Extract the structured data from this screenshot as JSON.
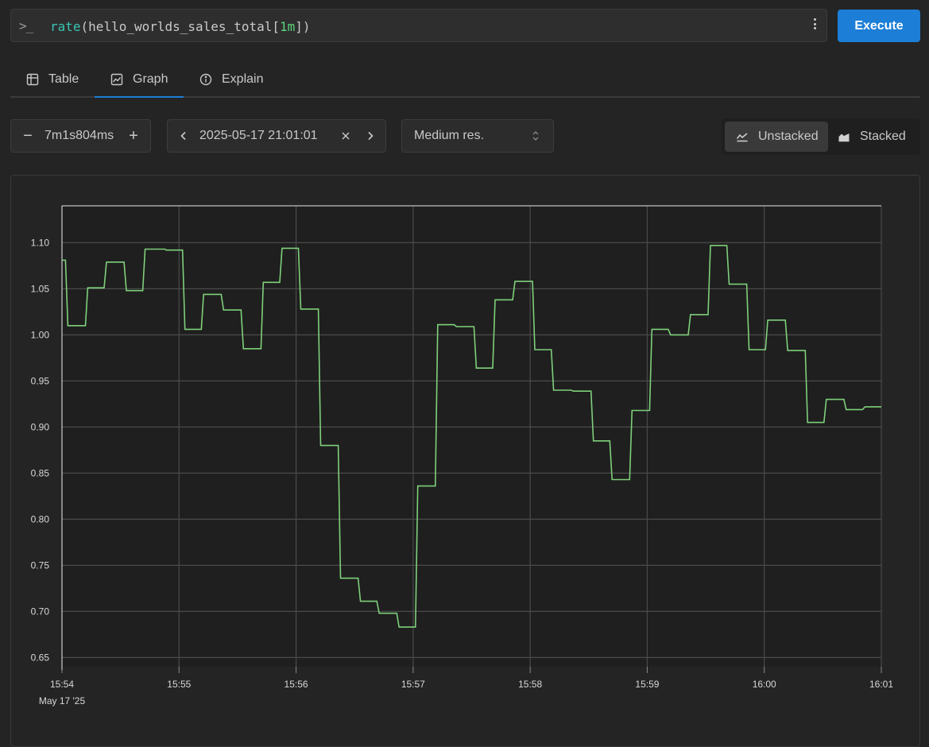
{
  "query": {
    "prompt": ">_",
    "fn": "rate",
    "open": "(",
    "metric": "hello_worlds_sales_total",
    "range_open": "[",
    "range": "1m",
    "close": "])",
    "more_icon": "dots-vertical-icon"
  },
  "execute_label": "Execute",
  "tabs": [
    {
      "label": "Table",
      "icon": "table-icon",
      "active": false
    },
    {
      "label": "Graph",
      "icon": "chart-area-icon",
      "active": true
    },
    {
      "label": "Explain",
      "icon": "info-circle-icon",
      "active": false
    }
  ],
  "controls": {
    "range_value": "7m1s804ms",
    "range_minus": "−",
    "range_plus": "+",
    "end_time": "2025-05-17 21:01:01",
    "resolution": "Medium res.",
    "unstacked_label": "Unstacked",
    "stacked_label": "Stacked"
  },
  "colors": {
    "accent": "#1c7ed6",
    "series": "#7ed07a",
    "background": "#242424"
  },
  "chart_data": {
    "type": "line",
    "x_ticks": [
      "15:54",
      "15:55",
      "15:56",
      "15:57",
      "15:58",
      "15:59",
      "16:00",
      "16:01"
    ],
    "x_date_label": "May 17 '25",
    "xlim_minutes": [
      0,
      7
    ],
    "ylim": [
      0.64,
      1.14
    ],
    "y_ticks": [
      "0.65",
      "0.70",
      "0.75",
      "0.80",
      "0.85",
      "0.90",
      "0.95",
      "1.00",
      "1.05",
      "1.10"
    ],
    "grid": true,
    "series": [
      {
        "step": true,
        "points": [
          [
            0.0,
            1.081
          ],
          [
            0.03,
            1.081
          ],
          [
            0.05,
            1.01
          ],
          [
            0.2,
            1.01
          ],
          [
            0.22,
            1.051
          ],
          [
            0.36,
            1.051
          ],
          [
            0.38,
            1.079
          ],
          [
            0.53,
            1.079
          ],
          [
            0.55,
            1.048
          ],
          [
            0.69,
            1.048
          ],
          [
            0.71,
            1.093
          ],
          [
            0.88,
            1.093
          ],
          [
            0.89,
            1.092
          ],
          [
            1.03,
            1.092
          ],
          [
            1.05,
            1.006
          ],
          [
            1.19,
            1.006
          ],
          [
            1.21,
            1.044
          ],
          [
            1.36,
            1.044
          ],
          [
            1.38,
            1.027
          ],
          [
            1.53,
            1.027
          ],
          [
            1.55,
            0.985
          ],
          [
            1.7,
            0.985
          ],
          [
            1.72,
            1.057
          ],
          [
            1.86,
            1.057
          ],
          [
            1.88,
            1.094
          ],
          [
            2.02,
            1.094
          ],
          [
            2.04,
            1.028
          ],
          [
            2.19,
            1.028
          ],
          [
            2.21,
            0.88
          ],
          [
            2.36,
            0.88
          ],
          [
            2.38,
            0.736
          ],
          [
            2.53,
            0.736
          ],
          [
            2.55,
            0.711
          ],
          [
            2.69,
            0.711
          ],
          [
            2.71,
            0.698
          ],
          [
            2.86,
            0.698
          ],
          [
            2.88,
            0.683
          ],
          [
            3.02,
            0.683
          ],
          [
            3.04,
            0.836
          ],
          [
            3.19,
            0.836
          ],
          [
            3.21,
            1.011
          ],
          [
            3.35,
            1.011
          ],
          [
            3.37,
            1.009
          ],
          [
            3.52,
            1.009
          ],
          [
            3.54,
            0.964
          ],
          [
            3.68,
            0.964
          ],
          [
            3.7,
            1.038
          ],
          [
            3.85,
            1.038
          ],
          [
            3.87,
            1.058
          ],
          [
            4.02,
            1.058
          ],
          [
            4.04,
            0.984
          ],
          [
            4.18,
            0.984
          ],
          [
            4.2,
            0.94
          ],
          [
            4.35,
            0.94
          ],
          [
            4.37,
            0.939
          ],
          [
            4.52,
            0.939
          ],
          [
            4.54,
            0.885
          ],
          [
            4.68,
            0.885
          ],
          [
            4.7,
            0.843
          ],
          [
            4.85,
            0.843
          ],
          [
            4.87,
            0.918
          ],
          [
            5.02,
            0.918
          ],
          [
            5.04,
            1.006
          ],
          [
            5.18,
            1.006
          ],
          [
            5.2,
            1.0
          ],
          [
            5.35,
            1.0
          ],
          [
            5.37,
            1.022
          ],
          [
            5.52,
            1.022
          ],
          [
            5.54,
            1.097
          ],
          [
            5.68,
            1.097
          ],
          [
            5.7,
            1.055
          ],
          [
            5.85,
            1.055
          ],
          [
            5.87,
            0.984
          ],
          [
            6.01,
            0.984
          ],
          [
            6.03,
            1.016
          ],
          [
            6.18,
            1.016
          ],
          [
            6.2,
            0.983
          ],
          [
            6.35,
            0.983
          ],
          [
            6.37,
            0.905
          ],
          [
            6.51,
            0.905
          ],
          [
            6.53,
            0.93
          ],
          [
            6.68,
            0.93
          ],
          [
            6.7,
            0.919
          ],
          [
            6.84,
            0.919
          ],
          [
            6.86,
            0.922
          ],
          [
            7.0,
            0.922
          ]
        ]
      }
    ]
  }
}
